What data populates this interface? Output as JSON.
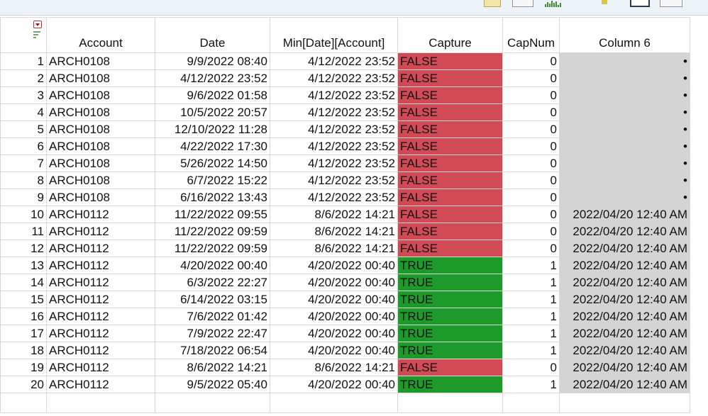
{
  "columns": {
    "account": "Account",
    "date": "Date",
    "min": "Min[Date][Account]",
    "capture": "Capture",
    "capnum": "CapNum",
    "col6": "Column 6"
  },
  "rows": [
    {
      "n": "1",
      "account": "ARCH0108",
      "date": "9/9/2022 08:40",
      "min": "4/12/2022 23:52",
      "capture": "FALSE",
      "capnum": "0",
      "col6": "•"
    },
    {
      "n": "2",
      "account": "ARCH0108",
      "date": "4/12/2022 23:52",
      "min": "4/12/2022 23:52",
      "capture": "FALSE",
      "capnum": "0",
      "col6": "•"
    },
    {
      "n": "3",
      "account": "ARCH0108",
      "date": "9/6/2022 01:58",
      "min": "4/12/2022 23:52",
      "capture": "FALSE",
      "capnum": "0",
      "col6": "•"
    },
    {
      "n": "4",
      "account": "ARCH0108",
      "date": "10/5/2022 20:57",
      "min": "4/12/2022 23:52",
      "capture": "FALSE",
      "capnum": "0",
      "col6": "•"
    },
    {
      "n": "5",
      "account": "ARCH0108",
      "date": "12/10/2022 11:28",
      "min": "4/12/2022 23:52",
      "capture": "FALSE",
      "capnum": "0",
      "col6": "•"
    },
    {
      "n": "6",
      "account": "ARCH0108",
      "date": "4/22/2022 17:30",
      "min": "4/12/2022 23:52",
      "capture": "FALSE",
      "capnum": "0",
      "col6": "•"
    },
    {
      "n": "7",
      "account": "ARCH0108",
      "date": "5/26/2022 14:50",
      "min": "4/12/2022 23:52",
      "capture": "FALSE",
      "capnum": "0",
      "col6": "•"
    },
    {
      "n": "8",
      "account": "ARCH0108",
      "date": "6/7/2022 15:22",
      "min": "4/12/2022 23:52",
      "capture": "FALSE",
      "capnum": "0",
      "col6": "•"
    },
    {
      "n": "9",
      "account": "ARCH0108",
      "date": "6/16/2022 13:43",
      "min": "4/12/2022 23:52",
      "capture": "FALSE",
      "capnum": "0",
      "col6": "•"
    },
    {
      "n": "10",
      "account": "ARCH0112",
      "date": "11/22/2022 09:55",
      "min": "8/6/2022 14:21",
      "capture": "FALSE",
      "capnum": "0",
      "col6": "2022/04/20 12:40 AM"
    },
    {
      "n": "11",
      "account": "ARCH0112",
      "date": "11/22/2022 09:59",
      "min": "8/6/2022 14:21",
      "capture": "FALSE",
      "capnum": "0",
      "col6": "2022/04/20 12:40 AM"
    },
    {
      "n": "12",
      "account": "ARCH0112",
      "date": "11/22/2022 09:59",
      "min": "8/6/2022 14:21",
      "capture": "FALSE",
      "capnum": "0",
      "col6": "2022/04/20 12:40 AM"
    },
    {
      "n": "13",
      "account": "ARCH0112",
      "date": "4/20/2022 00:40",
      "min": "4/20/2022 00:40",
      "capture": "TRUE",
      "capnum": "1",
      "col6": "2022/04/20 12:40 AM"
    },
    {
      "n": "14",
      "account": "ARCH0112",
      "date": "6/3/2022 22:27",
      "min": "4/20/2022 00:40",
      "capture": "TRUE",
      "capnum": "1",
      "col6": "2022/04/20 12:40 AM"
    },
    {
      "n": "15",
      "account": "ARCH0112",
      "date": "6/14/2022 03:15",
      "min": "4/20/2022 00:40",
      "capture": "TRUE",
      "capnum": "1",
      "col6": "2022/04/20 12:40 AM"
    },
    {
      "n": "16",
      "account": "ARCH0112",
      "date": "7/6/2022 01:42",
      "min": "4/20/2022 00:40",
      "capture": "TRUE",
      "capnum": "1",
      "col6": "2022/04/20 12:40 AM"
    },
    {
      "n": "17",
      "account": "ARCH0112",
      "date": "7/9/2022 22:47",
      "min": "4/20/2022 00:40",
      "capture": "TRUE",
      "capnum": "1",
      "col6": "2022/04/20 12:40 AM"
    },
    {
      "n": "18",
      "account": "ARCH0112",
      "date": "7/18/2022 06:54",
      "min": "4/20/2022 00:40",
      "capture": "TRUE",
      "capnum": "1",
      "col6": "2022/04/20 12:40 AM"
    },
    {
      "n": "19",
      "account": "ARCH0112",
      "date": "8/6/2022 14:21",
      "min": "8/6/2022 14:21",
      "capture": "FALSE",
      "capnum": "0",
      "col6": "2022/04/20 12:40 AM"
    },
    {
      "n": "20",
      "account": "ARCH0112",
      "date": "9/5/2022 05:40",
      "min": "4/20/2022 00:40",
      "capture": "TRUE",
      "capnum": "1",
      "col6": "2022/04/20 12:40 AM"
    }
  ],
  "colors": {
    "false_fill": "#d34a57",
    "true_fill": "#1e9a2a",
    "column6_fill": "#d4d4d4"
  },
  "icons": [
    "table-menu-icon",
    "sort-lines-icon",
    "toolbar-note-icon",
    "toolbar-table-icon",
    "toolbar-chart-icon",
    "toolbar-flag-icon",
    "toolbar-selected-icon",
    "toolbar-edit-icon"
  ]
}
